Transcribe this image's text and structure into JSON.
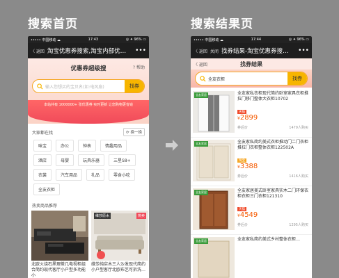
{
  "labels": {
    "left_heading": "搜索首页",
    "right_heading": "搜索结果页"
  },
  "colors": {
    "accent": "#f7b500",
    "red": "#f04a5a",
    "price": "#f55a00"
  },
  "screen1": {
    "status": {
      "carrier": "••••• 中国移动 ☁",
      "time": "17:43",
      "battery": "◎ ✦ 96% ▭"
    },
    "nav": {
      "back": "〈 返回",
      "title": "淘宝优惠券搜索,淘宝内部优…",
      "more": "•••"
    },
    "hero": {
      "title": "优惠券超级搜",
      "help": "? 帮助"
    },
    "search": {
      "placeholder": "输入您想买的宝贝名(如:电风扇)",
      "button": "找券"
    },
    "stats": "本站共有 1000000+ 张优惠券  实时更新 让您购物更省钱",
    "history": {
      "label": "大家都在找",
      "refresh": "⟳ 换一换"
    },
    "tags": [
      "味宝",
      "办公",
      "钟表",
      "情趣用品",
      "酒店",
      "母婴",
      "玩具乐器",
      "三星S8+",
      "衣裳",
      "汽车用品",
      "礼品",
      "零食小吃",
      "全友衣柜"
    ],
    "hot_label": "热卖商品推荐",
    "products": [
      {
        "desc": "北欧火烧石黑理茶几电视柜组合简约现代客厅小户型多功能小"
      },
      {
        "desc": "维莎纯实木三人沙发现代简约小户型客厅北欧布艺可拆洗…",
        "brand": "维莎原木",
        "tag": "热卖"
      }
    ]
  },
  "screen2": {
    "status": {
      "carrier": "••••• 中国移动 ☁",
      "time": "17:44",
      "battery": "◎ ✦ 96% ▭"
    },
    "nav": {
      "back": "〈 返回",
      "close": "关闭",
      "title": "找券结果-淘宝优惠券搜…",
      "more": "•••"
    },
    "topbar": {
      "back": "〈 返回",
      "title": "找券结果"
    },
    "search": {
      "value": "全友衣柜",
      "button": "找券"
    },
    "results": [
      {
        "title": "全友家私衣柜现代简约卧室家具衣柜推拉门移门整体大衣柜10702",
        "price": "2899",
        "coupon": "券后价",
        "sales": "1479人购买",
        "brand": "全友家居"
      },
      {
        "title": "全友家私简约美式衣柜推动门二门衣柜推拉门衣柜整体衣柜122502A",
        "price": "3388",
        "coupon": "券后价",
        "sales": "1416人购买",
        "brand": "全友家居"
      },
      {
        "title": "全友家居美式卧室家具实木二门环保衣柜衣柜三门衣柜121310",
        "price": "4549",
        "coupon": "券后价",
        "sales": "1295人购买",
        "brand": "全友家居"
      },
      {
        "title": "全友家私简约美式乡村整体衣柜…",
        "price": "",
        "coupon": "",
        "sales": "",
        "brand": "全友家居"
      }
    ]
  }
}
